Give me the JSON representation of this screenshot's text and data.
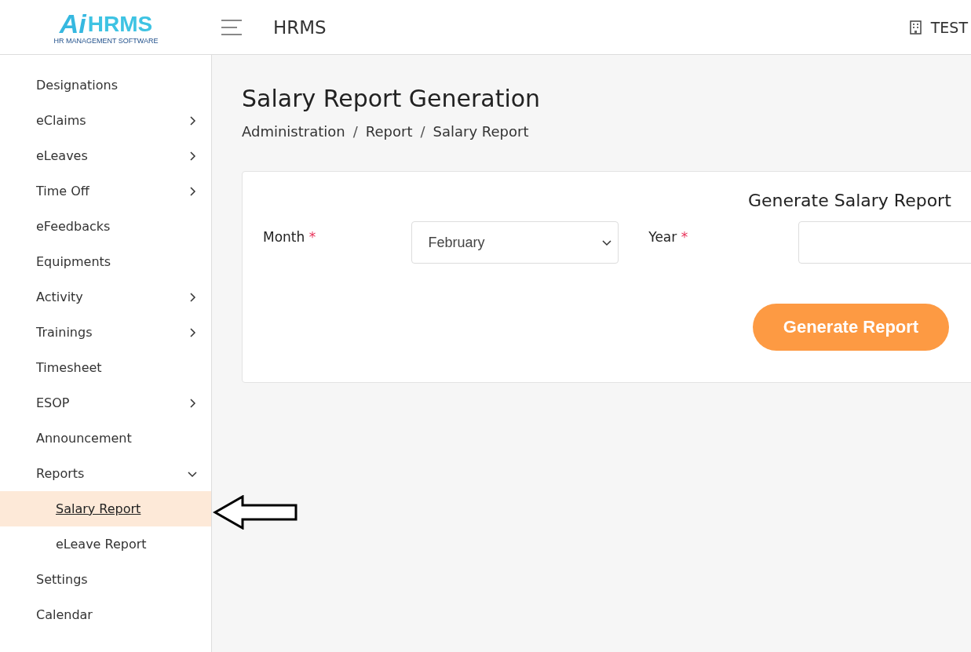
{
  "header": {
    "logo_mark": "Ai",
    "logo_text": "HRMS",
    "logo_tagline": "HR MANAGEMENT SOFTWARE",
    "app_title": "HRMS",
    "company": "TEST"
  },
  "sidebar": {
    "items": [
      {
        "label": "Designations",
        "kind": "link"
      },
      {
        "label": "eClaims",
        "kind": "group",
        "expanded": false
      },
      {
        "label": "eLeaves",
        "kind": "group",
        "expanded": false
      },
      {
        "label": "Time Off",
        "kind": "group",
        "expanded": false
      },
      {
        "label": "eFeedbacks",
        "kind": "link"
      },
      {
        "label": "Equipments",
        "kind": "link"
      },
      {
        "label": "Activity",
        "kind": "group",
        "expanded": false
      },
      {
        "label": "Trainings",
        "kind": "group",
        "expanded": false
      },
      {
        "label": "Timesheet",
        "kind": "link"
      },
      {
        "label": "ESOP",
        "kind": "group",
        "expanded": false
      },
      {
        "label": "Announcement",
        "kind": "link"
      },
      {
        "label": "Reports",
        "kind": "group",
        "expanded": true,
        "children": [
          {
            "label": "Salary Report",
            "selected": true
          },
          {
            "label": "eLeave Report",
            "selected": false
          }
        ]
      },
      {
        "label": "Settings",
        "kind": "link"
      },
      {
        "label": "Calendar",
        "kind": "link"
      }
    ]
  },
  "page": {
    "title": "Salary Report Generation",
    "breadcrumb": [
      "Administration",
      "Report",
      "Salary Report"
    ],
    "breadcrumb_separator": "/"
  },
  "form": {
    "title": "Generate Salary Report",
    "required_mark": "*",
    "fields": [
      {
        "label": "Month",
        "required": true,
        "value": "February"
      },
      {
        "label": "Year",
        "required": true
      }
    ],
    "button": "Generate Report"
  }
}
